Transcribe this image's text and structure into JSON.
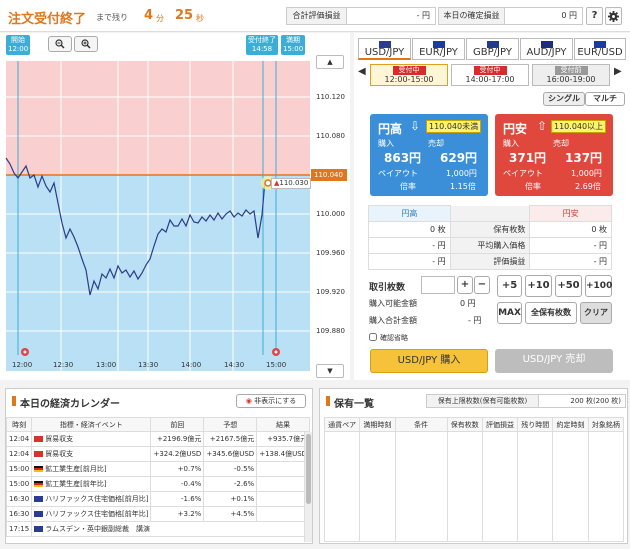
{
  "header": {
    "title": "注文受付終了",
    "remaining_label": "まで残り",
    "minutes": "4",
    "minutes_unit": "分",
    "seconds": "25",
    "seconds_unit": "秒",
    "total_pl_label": "合計評価損益",
    "total_pl_value": "- 円",
    "today_pl_label": "本日の確定損益",
    "today_pl_value": "0 円",
    "help_icon": "?",
    "settings_icon": "gear-icon"
  },
  "chart": {
    "start_tag": "開始",
    "start_time": "12:00",
    "close_tag": "受付終了",
    "close_time": "14:58",
    "end_tag": "満期",
    "end_time": "15:00",
    "current_price": "110.040",
    "current_rate": "110.030",
    "zoom_out_icon": "zoom-out-icon",
    "zoom_in_icon": "zoom-in-icon",
    "up_arrow": "▲",
    "down_arrow": "▼",
    "y_ticks": [
      "110.120",
      "110.080",
      "110.040",
      "110.000",
      "109.960",
      "109.920",
      "109.880"
    ],
    "x_ticks": [
      "12:30",
      "13:00",
      "13:30",
      "14:00",
      "14:30",
      "15:00"
    ]
  },
  "pairs": [
    {
      "label": "USD/JPY"
    },
    {
      "label": "EUR/JPY"
    },
    {
      "label": "GBP/JPY"
    },
    {
      "label": "AUD/JPY"
    },
    {
      "label": "EUR/USD"
    }
  ],
  "slots": [
    {
      "badge": "受付中",
      "time": "12:00-15:00"
    },
    {
      "badge": "受付中",
      "time": "14:00-17:00"
    },
    {
      "badge": "受付前",
      "time": "16:00-19:00"
    }
  ],
  "mode": {
    "single": "シングル",
    "multi": "マルチ"
  },
  "high_card": {
    "title": "円高",
    "cond": "110.040未満",
    "buy_label": "購入",
    "sell_label": "売却",
    "buy_price": "863円",
    "sell_price": "629円",
    "payout_label": "ペイアウト",
    "payout": "1,000円",
    "ratio_label": "倍率",
    "ratio": "1.15倍"
  },
  "low_card": {
    "title": "円安",
    "cond": "110.040以上",
    "buy_label": "購入",
    "sell_label": "売却",
    "buy_price": "371円",
    "sell_price": "137円",
    "payout_label": "ペイアウト",
    "payout": "1,000円",
    "ratio_label": "倍率",
    "ratio": "2.69倍"
  },
  "position_table": {
    "high": "円高",
    "low": "円安",
    "rows": [
      {
        "left": "0 枚",
        "label": "保有枚数",
        "right": "0 枚"
      },
      {
        "left": "- 円",
        "label": "平均購入価格",
        "right": "- 円"
      },
      {
        "left": "- 円",
        "label": "評価損益",
        "right": "- 円"
      }
    ]
  },
  "order": {
    "qty_label": "取引枚数",
    "plus": "+",
    "minus": "−",
    "avail_label": "購入可能金額",
    "avail_value": "0 円",
    "total_label": "購入合計金額",
    "total_value": "- 円",
    "q5": "+5",
    "q10": "+10",
    "q50": "+50",
    "q100": "+100",
    "max": "MAX",
    "all": "全保有枚数",
    "clear": "クリア",
    "confirm_label": "確認省略",
    "buy_button": "USD/JPY 購入",
    "sell_button": "USD/JPY 売却"
  },
  "calendar": {
    "title": "本日の経済カレンダー",
    "hide_button": "非表示にする",
    "headers": [
      "時刻",
      "指標・経済イベント",
      "前回",
      "予想",
      "結果"
    ],
    "rows": [
      {
        "time": "12:04",
        "flag": "cn",
        "event": "貿易収支",
        "prev": "+2196.9億元",
        "fc": "+2167.5億元",
        "res": "+935.7億元"
      },
      {
        "time": "12:04",
        "flag": "cn",
        "event": "貿易収支",
        "prev": "+324.2億USD",
        "fc": "+345.6億USD",
        "res": "+138.4億USD"
      },
      {
        "time": "15:00",
        "flag": "de",
        "event": "鉱工業生産[前月比]",
        "prev": "+0.7%",
        "fc": "-0.5%",
        "res": ""
      },
      {
        "time": "15:00",
        "flag": "de",
        "event": "鉱工業生産[前年比]",
        "prev": "-0.4%",
        "fc": "-2.6%",
        "res": ""
      },
      {
        "time": "16:30",
        "flag": "uk",
        "event": "ハリファックス住宅価格[前月比]",
        "prev": "-1.6%",
        "fc": "+0.1%",
        "res": ""
      },
      {
        "time": "16:30",
        "flag": "uk",
        "event": "ハリファックス住宅価格[前年比]",
        "prev": "+3.2%",
        "fc": "+4.5%",
        "res": ""
      },
      {
        "time": "17:15",
        "flag": "uk",
        "event": "ラムスデン・英中銀副総裁　講演",
        "prev": "",
        "fc": "",
        "res": ""
      }
    ]
  },
  "holdings": {
    "title": "保有一覧",
    "limit_label": "保有上限枚数(保有可能枚数)",
    "limit_value": "200 枚(200 枚)",
    "headers": [
      "通貨ペア",
      "満期時刻",
      "条件",
      "保有枚数",
      "評価損益",
      "残り時間",
      "約定時刻",
      "対象銘柄"
    ]
  }
}
